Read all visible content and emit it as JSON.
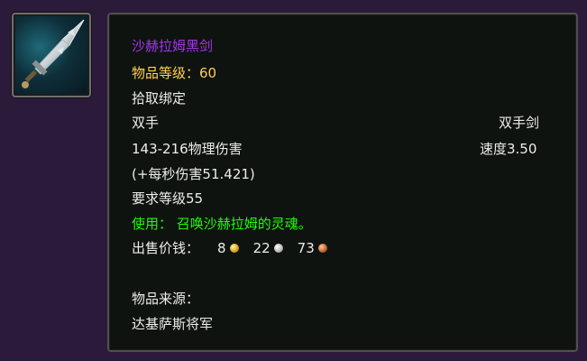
{
  "item": {
    "name": "沙赫拉姆黑剑",
    "item_level": "物品等级：60",
    "binding": "拾取绑定",
    "slot": "双手",
    "weapon_type": "双手剑",
    "damage": "143-216物理伤害",
    "speed": "速度3.50",
    "dps": "(+每秒伤害51.421)",
    "required_level": "要求等级55",
    "use_effect": "使用：  召唤沙赫拉姆的灵魂。",
    "sell_label": "出售价钱：",
    "sell_gold": "8",
    "sell_silver": "22",
    "sell_copper": "73",
    "source_label": "物品来源：",
    "source_value": "达基萨斯将军"
  },
  "colors": {
    "title": "#a335ee",
    "item_level": "#ffd34d",
    "use_effect": "#1eff00",
    "text": "#ececec"
  },
  "icons": {
    "item_icon": "sword-icon",
    "gold": "gold-coin-icon",
    "silver": "silver-coin-icon",
    "copper": "copper-coin-icon"
  }
}
